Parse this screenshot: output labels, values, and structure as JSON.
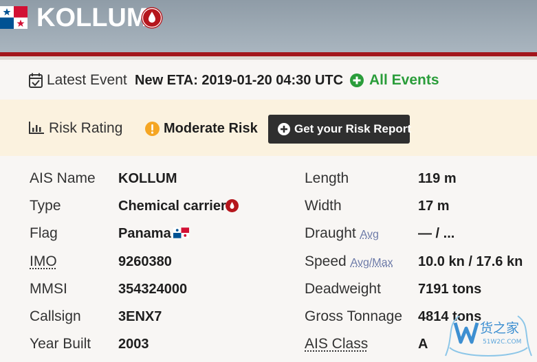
{
  "header": {
    "title": "KOLLUM",
    "flag_icon": "panama-flag-icon",
    "type_icon": "oil-drop-icon"
  },
  "event": {
    "label": "Latest Event",
    "value": "New ETA: 2019-01-20 04:30 UTC",
    "all_events_label": "All Events",
    "calendar_icon": "calendar-check-icon",
    "plus_icon": "plus-circle-icon"
  },
  "risk": {
    "label": "Risk Rating",
    "value": "Moderate Risk",
    "button_label": "Get your Risk Report",
    "chart_icon": "bar-chart-icon",
    "warning_icon": "exclamation-circle-icon"
  },
  "details": {
    "left": [
      {
        "label": "AIS Name",
        "value": "KOLLUM"
      },
      {
        "label": "Type",
        "value": "Chemical carrier"
      },
      {
        "label": "Flag",
        "value": "Panama"
      },
      {
        "label": "IMO",
        "value": "9260380"
      },
      {
        "label": "MMSI",
        "value": "354324000"
      },
      {
        "label": "Callsign",
        "value": "3ENX7"
      },
      {
        "label": "Year Built",
        "value": "2003"
      }
    ],
    "right": [
      {
        "label": "Length",
        "sub": "",
        "value": "119 m"
      },
      {
        "label": "Width",
        "sub": "",
        "value": "17 m"
      },
      {
        "label": "Draught",
        "sub": "Avg",
        "value": "— / ..."
      },
      {
        "label": "Speed",
        "sub": "Avg/Max",
        "value": "10.0 kn / 17.6 kn"
      },
      {
        "label": "Deadweight",
        "sub": "",
        "value": "7191 tons"
      },
      {
        "label": "Gross Tonnage",
        "sub": "",
        "value": "4814 tons"
      },
      {
        "label": "AIS Class",
        "sub": "",
        "value": "A"
      }
    ]
  },
  "watermark": {
    "text": "货之家",
    "subtext": "51W2C.COM"
  },
  "colors": {
    "accent_red": "#a3161b",
    "risk_orange": "#f5a623",
    "events_green": "#2a9d3a",
    "banner_yellow": "#fbf2df"
  }
}
